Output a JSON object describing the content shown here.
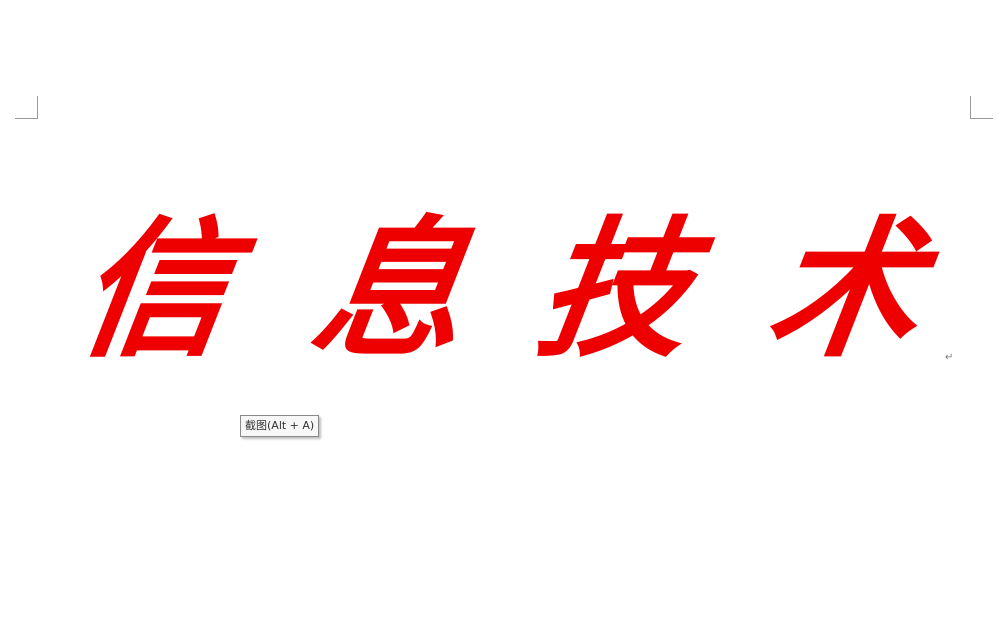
{
  "document": {
    "title_chars": [
      "信",
      "息",
      "技",
      "术"
    ],
    "paragraph_mark": "↵",
    "text_color": "#ee0000"
  },
  "tooltip": {
    "text": "截图(Alt + A)"
  }
}
